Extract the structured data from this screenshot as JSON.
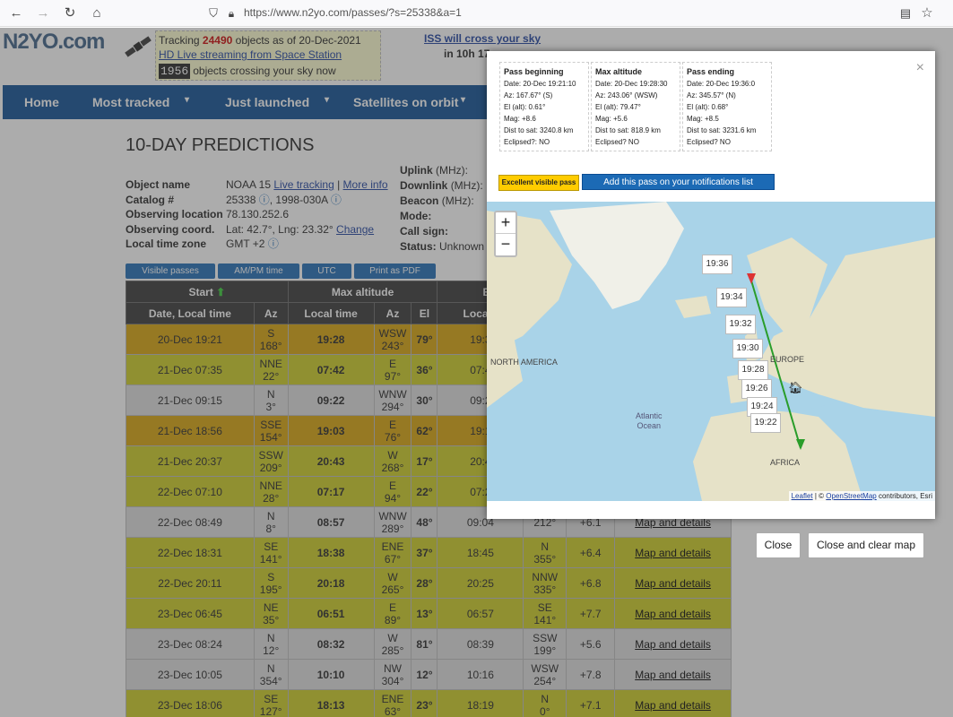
{
  "browser": {
    "url": "https://www.n2yo.com/passes/?s=25338&a=1",
    "url_host": "n2yo.com"
  },
  "site": {
    "logo": "N2YO.com",
    "tracking_prefix": "Tracking",
    "tracking_count": "24490",
    "tracking_suffix": "objects as of 20-Dec-2021",
    "hd_live": "HD Live streaming from Space Station",
    "counter": "1956",
    "crossing": "objects crossing your sky now",
    "iss_cross": "ISS will cross your sky",
    "iss_time": "in 10h 17"
  },
  "nav": [
    "Home",
    "Most tracked",
    "Just launched",
    "Satellites on orbit"
  ],
  "page": {
    "title": "10-DAY PREDICTIONS"
  },
  "info": {
    "object_label": "Object name",
    "object_value": "NOAA 15",
    "live_tracking": "Live tracking",
    "more_info": "More info",
    "catalog_label": "Catalog #",
    "catalog_value": "25338",
    "intl_value": "1998-030A",
    "location_label": "Observing location",
    "location_value": "78.130.252.6",
    "coord_label": "Observing coord.",
    "coord_value": "Lat: 42.7°, Lng: 23.32°",
    "change": "Change",
    "tz_label": "Local time zone",
    "tz_value": "GMT +2",
    "uplink": "Uplink",
    "uplink_unit": "(MHz):",
    "downlink": "Downlink",
    "downlink_unit": "(MHz):",
    "beacon": "Beacon",
    "beacon_unit": "(MHz):",
    "mode": "Mode:",
    "callsign": "Call sign:",
    "status": "Status:",
    "status_value": "Unknown"
  },
  "buttons": [
    "Visible passes",
    "AM/PM time",
    "UTC",
    "Print as PDF"
  ],
  "table": {
    "group_start": "Start",
    "group_max": "Max altitude",
    "group_end": "E",
    "cols": [
      "Date, Local time",
      "Az",
      "Local time",
      "Az",
      "El",
      "Local t"
    ],
    "rows": [
      {
        "date": "20-Dec 19:21",
        "az": "S\n168°",
        "max": "19:28",
        "maz": "WSW\n243°",
        "el": "79°",
        "end": "19:3",
        "eaz": "",
        "mag": "",
        "link": "",
        "bg": "#d8a206"
      },
      {
        "date": "21-Dec 07:35",
        "az": "NNE\n22°",
        "max": "07:42",
        "maz": "E\n97°",
        "el": "36°",
        "end": "07:4",
        "eaz": "",
        "mag": "",
        "link": "",
        "bg": "#cccc20"
      },
      {
        "date": "21-Dec 09:15",
        "az": "N\n3°",
        "max": "09:22",
        "maz": "WNW\n294°",
        "el": "30°",
        "end": "09:2",
        "eaz": "",
        "mag": "",
        "link": "",
        "bg": "#ddd"
      },
      {
        "date": "21-Dec 18:56",
        "az": "SSE\n154°",
        "max": "19:03",
        "maz": "E\n76°",
        "el": "62°",
        "end": "19:1",
        "eaz": "",
        "mag": "",
        "link": "",
        "bg": "#d8a206"
      },
      {
        "date": "21-Dec 20:37",
        "az": "SSW\n209°",
        "max": "20:43",
        "maz": "W\n268°",
        "el": "17°",
        "end": "20:4",
        "eaz": "",
        "mag": "",
        "link": "",
        "bg": "#cccc20"
      },
      {
        "date": "22-Dec 07:10",
        "az": "NNE\n28°",
        "max": "07:17",
        "maz": "E\n94°",
        "el": "22°",
        "end": "07:2",
        "eaz": "",
        "mag": "",
        "link": "",
        "bg": "#cccc20"
      },
      {
        "date": "22-Dec 08:49",
        "az": "N\n8°",
        "max": "08:57",
        "maz": "WNW\n289°",
        "el": "48°",
        "end": "09:04",
        "eaz": "212°",
        "mag": "+6.1",
        "link": "Map and details",
        "bg": "#ddd"
      },
      {
        "date": "22-Dec 18:31",
        "az": "SE\n141°",
        "max": "18:38",
        "maz": "ENE\n67°",
        "el": "37°",
        "end": "18:45",
        "eaz": "N\n355°",
        "mag": "+6.4",
        "link": "Map and details",
        "bg": "#cccc20"
      },
      {
        "date": "22-Dec 20:11",
        "az": "S\n195°",
        "max": "20:18",
        "maz": "W\n265°",
        "el": "28°",
        "end": "20:25",
        "eaz": "NNW\n335°",
        "mag": "+6.8",
        "link": "Map and details",
        "bg": "#cccc20"
      },
      {
        "date": "23-Dec 06:45",
        "az": "NE\n35°",
        "max": "06:51",
        "maz": "E\n89°",
        "el": "13°",
        "end": "06:57",
        "eaz": "SE\n141°",
        "mag": "+7.7",
        "link": "Map and details",
        "bg": "#cccc20"
      },
      {
        "date": "23-Dec 08:24",
        "az": "N\n12°",
        "max": "08:32",
        "maz": "W\n285°",
        "el": "81°",
        "end": "08:39",
        "eaz": "SSW\n199°",
        "mag": "+5.6",
        "link": "Map and details",
        "bg": "#ddd"
      },
      {
        "date": "23-Dec 10:05",
        "az": "N\n354°",
        "max": "10:10",
        "maz": "NW\n304°",
        "el": "12°",
        "end": "10:16",
        "eaz": "WSW\n254°",
        "mag": "+7.8",
        "link": "Map and details",
        "bg": "#ddd"
      },
      {
        "date": "23-Dec 18:06",
        "az": "SE\n127°",
        "max": "18:13",
        "maz": "ENE\n63°",
        "el": "23°",
        "end": "18:19",
        "eaz": "N\n0°",
        "mag": "+7.1",
        "link": "Map and details",
        "bg": "#cccc20"
      }
    ]
  },
  "modal": {
    "begin": {
      "title": "Pass beginning",
      "date": "Date: 20-Dec 19:21:10",
      "az": "Az: 167.67° (S)",
      "el": "El (alt): 0.61°",
      "mag": "Mag: +8.6",
      "dist": "Dist to sat: 3240.8 km",
      "ecl": "Eclipsed?: NO"
    },
    "max": {
      "title": "Max altitude",
      "date": "Date: 20-Dec 19:28:30",
      "az": "Az: 243.06° (WSW)",
      "el": "El (alt): 79.47°",
      "mag": "Mag: +5.6",
      "dist": "Dist to sat: 818.9 km",
      "ecl": "Eclipsed? NO"
    },
    "end": {
      "title": "Pass ending",
      "date": "Date: 20-Dec 19:36:0",
      "az": "Az: 345.57° (N)",
      "el": "El (alt): 0.68°",
      "mag": "Mag: +8.5",
      "dist": "Dist to sat: 3231.6 km",
      "ecl": "Eclipsed? NO"
    },
    "close_x": "×",
    "badge": "Excellent visible pass",
    "notify": "Add this pass on your notifications list",
    "map": {
      "zoom_in": "+",
      "zoom_out": "−",
      "na": "NORTH AMERICA",
      "europe": "EUROPE",
      "africa": "AFRICA",
      "ocean1": "Atlantic",
      "ocean2": "Ocean",
      "attr_leaflet": "Leaflet",
      "attr_sep": " | © ",
      "attr_osm": "OpenStreetMap",
      "attr_rest": " contributors, Esri",
      "times": [
        "19:36",
        "19:34",
        "19:32",
        "19:30",
        "19:28",
        "19:26",
        "19:24",
        "19:22"
      ]
    }
  },
  "actions": {
    "close": "Close",
    "close_clear": "Close and clear map"
  },
  "colors": {
    "nav": "#0a4c93",
    "excellent": "#d8a206",
    "visible": "#cccc20",
    "water": "#a9d3e8",
    "land": "#e6e2c8"
  }
}
